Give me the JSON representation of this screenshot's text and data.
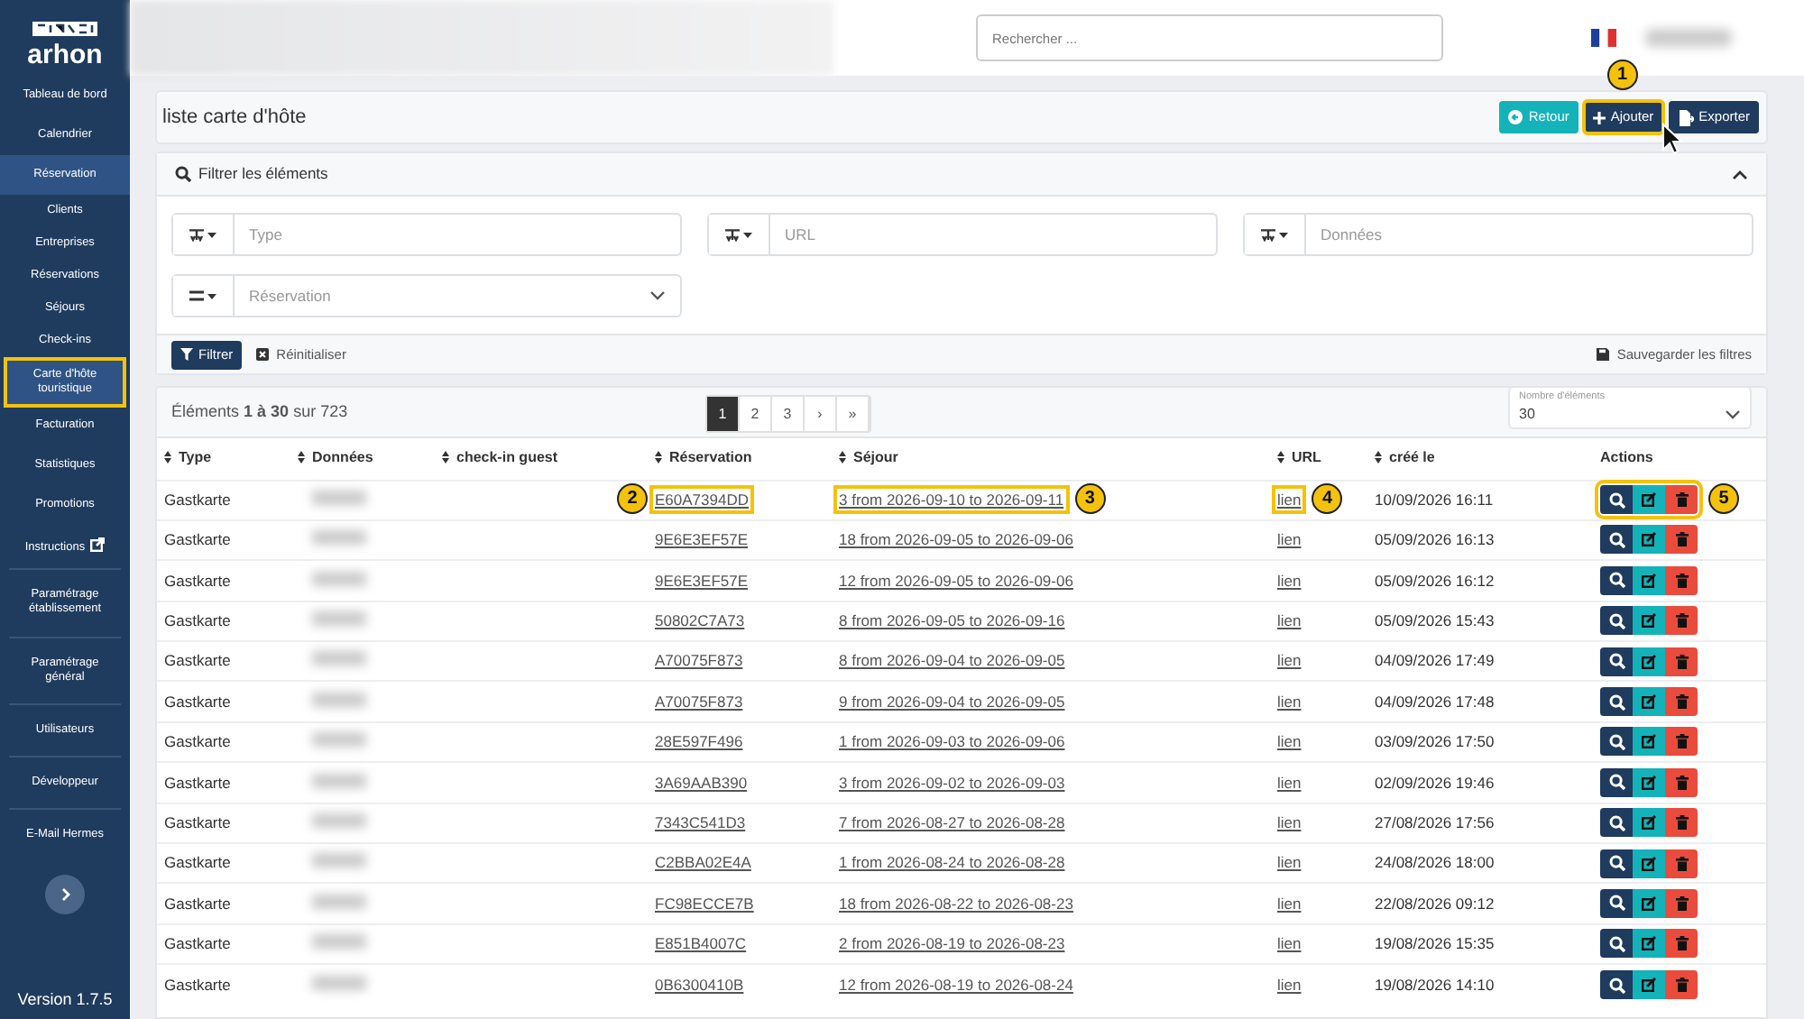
{
  "sidebar": {
    "logo": "arhon",
    "items": [
      {
        "label": "Tableau de bord",
        "kind": "main",
        "selected": false,
        "highlight": false
      },
      {
        "label": "Calendrier",
        "kind": "main",
        "selected": false,
        "highlight": false
      },
      {
        "label": "Réservation",
        "kind": "main",
        "selected": true,
        "highlight": false
      },
      {
        "label": "Clients",
        "kind": "sub",
        "selected": false,
        "highlight": false
      },
      {
        "label": "Entreprises",
        "kind": "sub",
        "selected": false,
        "highlight": false
      },
      {
        "label": "Réservations",
        "kind": "sub",
        "selected": false,
        "highlight": false
      },
      {
        "label": "Séjours",
        "kind": "sub",
        "selected": false,
        "highlight": false
      },
      {
        "label": "Check-ins",
        "kind": "sub",
        "selected": false,
        "highlight": false
      },
      {
        "label": "Carte d'hôte touristique",
        "kind": "sub",
        "selected": true,
        "highlight": true
      },
      {
        "label": "Facturation",
        "kind": "main",
        "selected": false,
        "highlight": false
      },
      {
        "label": "Statistiques",
        "kind": "main",
        "selected": false,
        "highlight": false
      },
      {
        "label": "Promotions",
        "kind": "main",
        "selected": false,
        "highlight": false
      },
      {
        "label": "Instructions",
        "kind": "external",
        "selected": false,
        "highlight": false
      },
      {
        "label": "Paramétrage établissement",
        "kind": "section",
        "selected": false,
        "highlight": false
      },
      {
        "label": "Paramétrage général",
        "kind": "section",
        "selected": false,
        "highlight": false
      },
      {
        "label": "Utilisateurs",
        "kind": "section",
        "selected": false,
        "highlight": false
      },
      {
        "label": "Développeur",
        "kind": "section",
        "selected": false,
        "highlight": false
      },
      {
        "label": "E-Mail Hermes",
        "kind": "section",
        "selected": false,
        "highlight": false
      }
    ],
    "version": "Version 1.7.5"
  },
  "topbar": {
    "search": {
      "placeholder": "Rechercher ..."
    }
  },
  "page": {
    "title": "liste carte d'hôte",
    "buttons": [
      {
        "label": "Retour",
        "kind": "back",
        "highlight": false
      },
      {
        "label": "Ajouter",
        "kind": "add",
        "highlight": true,
        "callout": "1"
      },
      {
        "label": "Exporter",
        "kind": "export",
        "highlight": false
      }
    ]
  },
  "filter": {
    "title": "Filtrer les éléments",
    "expanded": true,
    "fields": [
      {
        "kind": "text",
        "placeholder": "Type",
        "dropdown": false
      },
      {
        "kind": "text",
        "placeholder": "URL",
        "dropdown": false
      },
      {
        "kind": "text",
        "placeholder": "Données",
        "dropdown": false
      },
      {
        "kind": "equals",
        "placeholder": "Réservation",
        "dropdown": true
      }
    ],
    "apply": "Filtrer",
    "reset": "Réinitialiser",
    "save": "Sauvegarder les filtres"
  },
  "table": {
    "summary": "Éléments **1 à 30** sur 723",
    "pagination": [
      {
        "label": "1",
        "selected": true
      },
      {
        "label": "2",
        "selected": false
      },
      {
        "label": "3",
        "selected": false
      },
      {
        "label": "›",
        "selected": false
      },
      {
        "label": "»",
        "selected": false
      }
    ],
    "page_size": {
      "label": "Nombre d'éléments",
      "value": "30"
    },
    "columns": [
      {
        "label": "Type",
        "sortable": true
      },
      {
        "label": "Données",
        "sortable": true
      },
      {
        "label": "check-in guest",
        "sortable": true
      },
      {
        "label": "Réservation",
        "sortable": true
      },
      {
        "label": "Séjour",
        "sortable": true
      },
      {
        "label": "URL",
        "sortable": true
      },
      {
        "label": "créé le",
        "sortable": true
      },
      {
        "label": "Actions",
        "sortable": false
      }
    ],
    "rows": [
      {
        "type": "Gastkarte",
        "reservation": "E60A7394DD",
        "sejour": "3 from 2026-09-10 to 2026-09-11",
        "url": "lien",
        "created": "10/09/2026 16:11",
        "highlight": true,
        "callouts": {
          "reservation": "2",
          "sejour": "3",
          "url": "4",
          "actions": "5"
        }
      },
      {
        "type": "Gastkarte",
        "reservation": "9E6E3EF57E",
        "sejour": "18 from 2026-09-05 to 2026-09-06",
        "url": "lien",
        "created": "05/09/2026 16:13",
        "highlight": false
      },
      {
        "type": "Gastkarte",
        "reservation": "9E6E3EF57E",
        "sejour": "12 from 2026-09-05 to 2026-09-06",
        "url": "lien",
        "created": "05/09/2026 16:12",
        "highlight": false
      },
      {
        "type": "Gastkarte",
        "reservation": "50802C7A73",
        "sejour": "8 from 2026-09-05 to 2026-09-16",
        "url": "lien",
        "created": "05/09/2026 15:43",
        "highlight": false
      },
      {
        "type": "Gastkarte",
        "reservation": "A70075F873",
        "sejour": "8 from 2026-09-04 to 2026-09-05",
        "url": "lien",
        "created": "04/09/2026 17:49",
        "highlight": false
      },
      {
        "type": "Gastkarte",
        "reservation": "A70075F873",
        "sejour": "9 from 2026-09-04 to 2026-09-05",
        "url": "lien",
        "created": "04/09/2026 17:48",
        "highlight": false
      },
      {
        "type": "Gastkarte",
        "reservation": "28E597F496",
        "sejour": "1 from 2026-09-03 to 2026-09-06",
        "url": "lien",
        "created": "03/09/2026 17:50",
        "highlight": false
      },
      {
        "type": "Gastkarte",
        "reservation": "3A69AAB390",
        "sejour": "3 from 2026-09-02 to 2026-09-03",
        "url": "lien",
        "created": "02/09/2026 19:46",
        "highlight": false
      },
      {
        "type": "Gastkarte",
        "reservation": "7343C541D3",
        "sejour": "7 from 2026-08-27 to 2026-08-28",
        "url": "lien",
        "created": "27/08/2026 17:56",
        "highlight": false
      },
      {
        "type": "Gastkarte",
        "reservation": "C2BBA02E4A",
        "sejour": "1 from 2026-08-24 to 2026-08-28",
        "url": "lien",
        "created": "24/08/2026 18:00",
        "highlight": false
      },
      {
        "type": "Gastkarte",
        "reservation": "FC98ECCE7B",
        "sejour": "18 from 2026-08-22 to 2026-08-23",
        "url": "lien",
        "created": "22/08/2026 09:12",
        "highlight": false
      },
      {
        "type": "Gastkarte",
        "reservation": "E851B4007C",
        "sejour": "2 from 2026-08-19 to 2026-08-23",
        "url": "lien",
        "created": "19/08/2026 15:35",
        "highlight": false
      },
      {
        "type": "Gastkarte",
        "reservation": "0B6300410B",
        "sejour": "12 from 2026-08-19 to 2026-08-24",
        "url": "lien",
        "created": "19/08/2026 14:10",
        "highlight": false
      }
    ]
  }
}
